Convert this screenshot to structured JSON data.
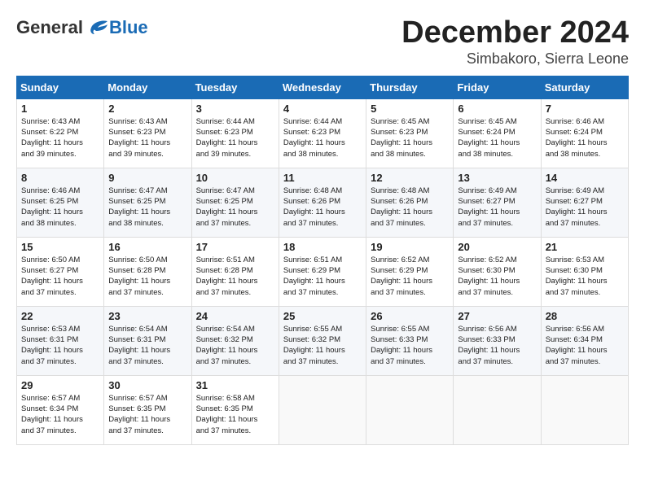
{
  "header": {
    "logo_general": "General",
    "logo_blue": "Blue",
    "month_title": "December 2024",
    "subtitle": "Simbakoro, Sierra Leone"
  },
  "weekdays": [
    "Sunday",
    "Monday",
    "Tuesday",
    "Wednesday",
    "Thursday",
    "Friday",
    "Saturday"
  ],
  "weeks": [
    [
      {
        "day": "1",
        "info": "Sunrise: 6:43 AM\nSunset: 6:22 PM\nDaylight: 11 hours\nand 39 minutes."
      },
      {
        "day": "2",
        "info": "Sunrise: 6:43 AM\nSunset: 6:23 PM\nDaylight: 11 hours\nand 39 minutes."
      },
      {
        "day": "3",
        "info": "Sunrise: 6:44 AM\nSunset: 6:23 PM\nDaylight: 11 hours\nand 39 minutes."
      },
      {
        "day": "4",
        "info": "Sunrise: 6:44 AM\nSunset: 6:23 PM\nDaylight: 11 hours\nand 38 minutes."
      },
      {
        "day": "5",
        "info": "Sunrise: 6:45 AM\nSunset: 6:23 PM\nDaylight: 11 hours\nand 38 minutes."
      },
      {
        "day": "6",
        "info": "Sunrise: 6:45 AM\nSunset: 6:24 PM\nDaylight: 11 hours\nand 38 minutes."
      },
      {
        "day": "7",
        "info": "Sunrise: 6:46 AM\nSunset: 6:24 PM\nDaylight: 11 hours\nand 38 minutes."
      }
    ],
    [
      {
        "day": "8",
        "info": "Sunrise: 6:46 AM\nSunset: 6:25 PM\nDaylight: 11 hours\nand 38 minutes."
      },
      {
        "day": "9",
        "info": "Sunrise: 6:47 AM\nSunset: 6:25 PM\nDaylight: 11 hours\nand 38 minutes."
      },
      {
        "day": "10",
        "info": "Sunrise: 6:47 AM\nSunset: 6:25 PM\nDaylight: 11 hours\nand 37 minutes."
      },
      {
        "day": "11",
        "info": "Sunrise: 6:48 AM\nSunset: 6:26 PM\nDaylight: 11 hours\nand 37 minutes."
      },
      {
        "day": "12",
        "info": "Sunrise: 6:48 AM\nSunset: 6:26 PM\nDaylight: 11 hours\nand 37 minutes."
      },
      {
        "day": "13",
        "info": "Sunrise: 6:49 AM\nSunset: 6:27 PM\nDaylight: 11 hours\nand 37 minutes."
      },
      {
        "day": "14",
        "info": "Sunrise: 6:49 AM\nSunset: 6:27 PM\nDaylight: 11 hours\nand 37 minutes."
      }
    ],
    [
      {
        "day": "15",
        "info": "Sunrise: 6:50 AM\nSunset: 6:27 PM\nDaylight: 11 hours\nand 37 minutes."
      },
      {
        "day": "16",
        "info": "Sunrise: 6:50 AM\nSunset: 6:28 PM\nDaylight: 11 hours\nand 37 minutes."
      },
      {
        "day": "17",
        "info": "Sunrise: 6:51 AM\nSunset: 6:28 PM\nDaylight: 11 hours\nand 37 minutes."
      },
      {
        "day": "18",
        "info": "Sunrise: 6:51 AM\nSunset: 6:29 PM\nDaylight: 11 hours\nand 37 minutes."
      },
      {
        "day": "19",
        "info": "Sunrise: 6:52 AM\nSunset: 6:29 PM\nDaylight: 11 hours\nand 37 minutes."
      },
      {
        "day": "20",
        "info": "Sunrise: 6:52 AM\nSunset: 6:30 PM\nDaylight: 11 hours\nand 37 minutes."
      },
      {
        "day": "21",
        "info": "Sunrise: 6:53 AM\nSunset: 6:30 PM\nDaylight: 11 hours\nand 37 minutes."
      }
    ],
    [
      {
        "day": "22",
        "info": "Sunrise: 6:53 AM\nSunset: 6:31 PM\nDaylight: 11 hours\nand 37 minutes."
      },
      {
        "day": "23",
        "info": "Sunrise: 6:54 AM\nSunset: 6:31 PM\nDaylight: 11 hours\nand 37 minutes."
      },
      {
        "day": "24",
        "info": "Sunrise: 6:54 AM\nSunset: 6:32 PM\nDaylight: 11 hours\nand 37 minutes."
      },
      {
        "day": "25",
        "info": "Sunrise: 6:55 AM\nSunset: 6:32 PM\nDaylight: 11 hours\nand 37 minutes."
      },
      {
        "day": "26",
        "info": "Sunrise: 6:55 AM\nSunset: 6:33 PM\nDaylight: 11 hours\nand 37 minutes."
      },
      {
        "day": "27",
        "info": "Sunrise: 6:56 AM\nSunset: 6:33 PM\nDaylight: 11 hours\nand 37 minutes."
      },
      {
        "day": "28",
        "info": "Sunrise: 6:56 AM\nSunset: 6:34 PM\nDaylight: 11 hours\nand 37 minutes."
      }
    ],
    [
      {
        "day": "29",
        "info": "Sunrise: 6:57 AM\nSunset: 6:34 PM\nDaylight: 11 hours\nand 37 minutes."
      },
      {
        "day": "30",
        "info": "Sunrise: 6:57 AM\nSunset: 6:35 PM\nDaylight: 11 hours\nand 37 minutes."
      },
      {
        "day": "31",
        "info": "Sunrise: 6:58 AM\nSunset: 6:35 PM\nDaylight: 11 hours\nand 37 minutes."
      },
      null,
      null,
      null,
      null
    ]
  ]
}
